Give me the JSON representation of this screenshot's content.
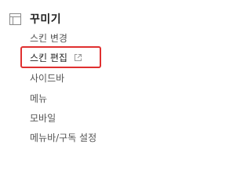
{
  "section": {
    "title": "꾸미기",
    "icon": "layout-icon"
  },
  "items": [
    {
      "label": "스킨 변경"
    },
    {
      "label": "스킨 편집",
      "icon": "external-link-icon"
    },
    {
      "label": "사이드바"
    },
    {
      "label": "메뉴"
    },
    {
      "label": "모바일"
    },
    {
      "label": "메뉴바/구독 설정"
    }
  ],
  "colors": {
    "highlight": "#e03030",
    "title": "#222222",
    "item": "#555555",
    "icon": "#9a9a9a"
  }
}
